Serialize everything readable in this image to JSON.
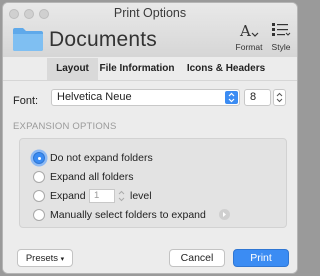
{
  "window": {
    "title": "Print Options"
  },
  "document": {
    "name": "Documents"
  },
  "toolbar": {
    "format_label": "Format",
    "style_label": "Style"
  },
  "tabs": [
    {
      "label": "Layout",
      "active": true
    },
    {
      "label": "File Information",
      "active": false
    },
    {
      "label": "Icons & Headers",
      "active": false
    }
  ],
  "font": {
    "label": "Font:",
    "value": "Helvetica Neue",
    "size": "8"
  },
  "expansion": {
    "section_label": "EXPANSION OPTIONS",
    "options": [
      {
        "label": "Do not expand folders",
        "selected": true
      },
      {
        "label": "Expand all folders",
        "selected": false
      },
      {
        "label": "Expand",
        "selected": false
      },
      {
        "label": "Manually select folders to expand",
        "selected": false
      }
    ],
    "level_value": "1",
    "level_label": "level"
  },
  "footer": {
    "presets_label": "Presets",
    "cancel_label": "Cancel",
    "print_label": "Print"
  },
  "colors": {
    "accent": "#3b8cf3",
    "folder": "#6fb3ee"
  }
}
